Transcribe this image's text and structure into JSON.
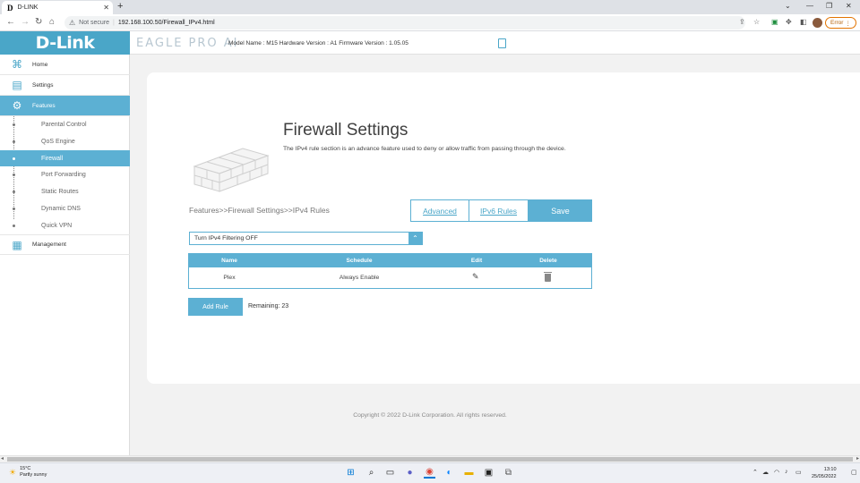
{
  "browser": {
    "tab_title": "D-LINK",
    "tab_favicon": "D",
    "url_security": "Not secure",
    "url": "192.168.100.50/Firewall_IPv4.html",
    "error_label": "Error"
  },
  "header": {
    "logo": "D-Link",
    "product": "EAGLE PRO AI",
    "model_info": "Model Name : M15  Hardware Version : A1  Firmware Version : 1.05.05"
  },
  "sidebar": {
    "main_items": [
      {
        "label": "Home",
        "icon": "home-network-icon"
      },
      {
        "label": "Settings",
        "icon": "settings-icon"
      },
      {
        "label": "Features",
        "icon": "features-icon"
      },
      {
        "label": "Management",
        "icon": "management-icon"
      }
    ],
    "sub_items": [
      {
        "label": "Parental Control"
      },
      {
        "label": "QoS Engine"
      },
      {
        "label": "Firewall"
      },
      {
        "label": "Port Forwarding"
      },
      {
        "label": "Static Routes"
      },
      {
        "label": "Dynamic DNS"
      },
      {
        "label": "Quick VPN"
      }
    ],
    "active_main": "Features",
    "active_sub": "Firewall"
  },
  "page": {
    "title": "Firewall Settings",
    "description": "The IPv4 rule section is an advance feature used to deny or allow traffic from passing through the device.",
    "breadcrumb": "Features>>Firewall Settings>>IPv4 Rules",
    "advanced_label": "Advanced",
    "ipv6_label": "IPv6 Rules",
    "save_label": "Save",
    "filter_select": "Turn IPv4 Filtering OFF",
    "table": {
      "headers": [
        "Name",
        "Schedule",
        "Edit",
        "Delete"
      ],
      "rows": [
        {
          "name": "Plex",
          "schedule": "Always Enable"
        }
      ]
    },
    "add_rule_label": "Add Rule",
    "remaining_label": "Remaining: 23",
    "copyright": "Copyright © 2022 D-Link Corporation. All rights reserved."
  },
  "taskbar": {
    "temperature": "15°C",
    "weather": "Partly sunny",
    "time": "13:10",
    "date": "25/05/2022"
  },
  "colors": {
    "accent": "#5cb0d3",
    "brand": "#4aa6c8"
  }
}
